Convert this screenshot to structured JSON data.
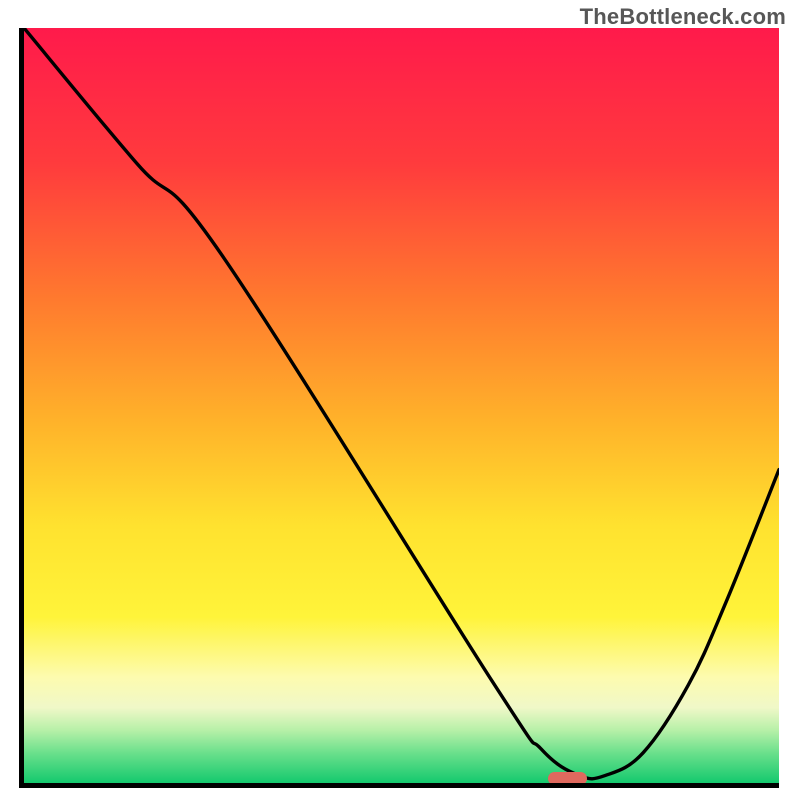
{
  "watermark": {
    "text": "TheBottleneck.com"
  },
  "chart_data": {
    "type": "line",
    "title": "",
    "xlabel": "",
    "ylabel": "",
    "xlim": [
      0,
      100
    ],
    "ylim": [
      0,
      100
    ],
    "gradient_stops": [
      {
        "offset": 0,
        "color": "#ff1a4b"
      },
      {
        "offset": 18,
        "color": "#ff3b3d"
      },
      {
        "offset": 36,
        "color": "#ff7a2e"
      },
      {
        "offset": 52,
        "color": "#ffb22a"
      },
      {
        "offset": 66,
        "color": "#ffe22f"
      },
      {
        "offset": 78,
        "color": "#fff43a"
      },
      {
        "offset": 86,
        "color": "#fdfbaf"
      },
      {
        "offset": 90,
        "color": "#f0f8c8"
      },
      {
        "offset": 93,
        "color": "#b7f0a8"
      },
      {
        "offset": 96,
        "color": "#6be08c"
      },
      {
        "offset": 100,
        "color": "#14c96e"
      }
    ],
    "series": [
      {
        "name": "bottleneck-curve",
        "x": [
          0.0,
          15.0,
          26.5,
          62.0,
          68.5,
          73.5,
          77.0,
          82.0,
          88.0,
          93.0,
          100.0
        ],
        "y": [
          100.0,
          82.0,
          69.5,
          13.5,
          4.5,
          1.0,
          1.0,
          4.0,
          13.0,
          24.0,
          41.5
        ]
      }
    ],
    "marker": {
      "name": "optimal-marker",
      "x_center": 72.0,
      "width_pct": 5.2,
      "y": 0.6,
      "height_pct": 1.6,
      "color": "#e0695e"
    }
  }
}
